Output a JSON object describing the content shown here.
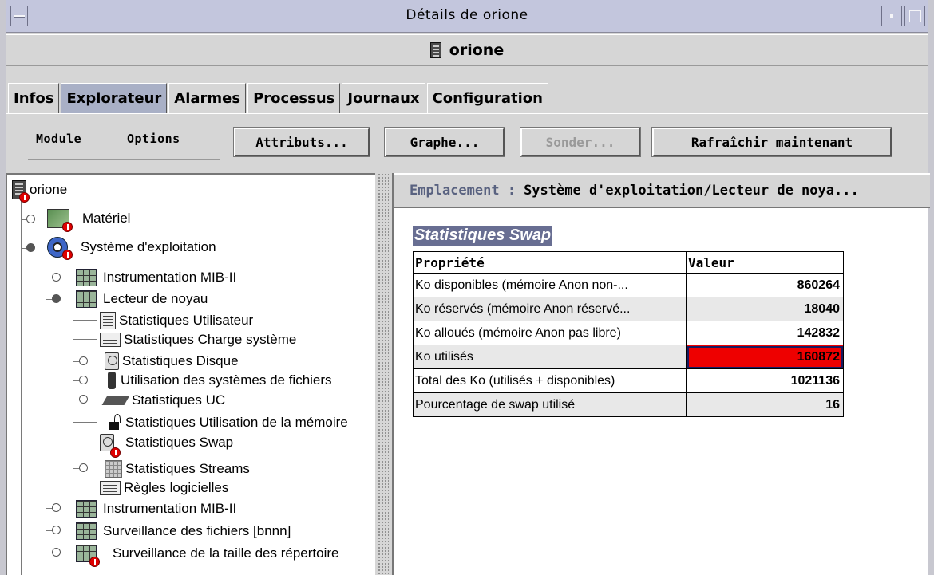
{
  "window": {
    "title": "Détails de orione"
  },
  "host": {
    "name": "orione"
  },
  "tabs": [
    {
      "label": "Infos",
      "active": false
    },
    {
      "label": "Explorateur",
      "active": true
    },
    {
      "label": "Alarmes",
      "active": false
    },
    {
      "label": "Processus",
      "active": false
    },
    {
      "label": "Journaux",
      "active": false
    },
    {
      "label": "Configuration",
      "active": false
    }
  ],
  "toolbar": {
    "menus": [
      "Module",
      "Options"
    ],
    "attributes_label": "Attributs...",
    "graph_label": "Graphe...",
    "probe_label": "Sonder...",
    "refresh_label": "Rafraîchir maintenant"
  },
  "tree": [
    {
      "label": "orione",
      "icon": "server-icon",
      "alarm": true
    },
    {
      "label": "Matériel",
      "icon": "hardware-icon",
      "alarm": true,
      "expander": "open"
    },
    {
      "label": "Système d'exploitation",
      "icon": "os-icon",
      "alarm": true,
      "expander": "filled"
    },
    {
      "label": "Instrumentation MIB-II",
      "icon": "module-icon",
      "expander": "open"
    },
    {
      "label": "Lecteur de noyau",
      "icon": "module-icon",
      "expander": "filled"
    },
    {
      "label": "Statistiques Utilisateur",
      "icon": "document-icon"
    },
    {
      "label": "Statistiques Charge système",
      "icon": "rules-icon"
    },
    {
      "label": "Statistiques Disque",
      "icon": "disk-icon",
      "expander": "open"
    },
    {
      "label": "Utilisation des systèmes de fichiers",
      "icon": "filesystem-icon",
      "expander": "open"
    },
    {
      "label": "Statistiques UC",
      "icon": "cpu-icon",
      "expander": "open"
    },
    {
      "label": "Statistiques Utilisation de la mémoire",
      "icon": "memory-icon"
    },
    {
      "label": "Statistiques Swap",
      "icon": "disk-icon",
      "alarm": true
    },
    {
      "label": "Statistiques Streams",
      "icon": "streams-icon",
      "expander": "open"
    },
    {
      "label": "Règles logicielles",
      "icon": "rules-icon"
    },
    {
      "label": "Instrumentation MIB-II",
      "icon": "module-icon",
      "expander": "open"
    },
    {
      "label": "Surveillance des fichiers [bnnn]",
      "icon": "module-icon",
      "expander": "open"
    },
    {
      "label": "Surveillance de la taille des répertoire",
      "icon": "module-icon",
      "alarm": true,
      "expander": "open"
    }
  ],
  "location": {
    "label": "Emplacement :",
    "value": "Système d'exploitation/Lecteur de noya..."
  },
  "section": {
    "title": "Statistiques Swap"
  },
  "table": {
    "headers": [
      "Propriété",
      "Valeur"
    ],
    "rows": [
      {
        "property": "Ko disponibles (mémoire Anon non-...",
        "value": "860264"
      },
      {
        "property": "Ko réservés (mémoire Anon réservé...",
        "value": "18040"
      },
      {
        "property": "Ko alloués (mémoire Anon pas libre)",
        "value": "142832"
      },
      {
        "property": "Ko utilisés",
        "value": "160872",
        "alarm": true
      },
      {
        "property": "Total des Ko (utilisés + disponibles)",
        "value": "1021136"
      },
      {
        "property": "Pourcentage de swap utilisé",
        "value": "16"
      }
    ]
  },
  "colors": {
    "title_bar": "#c3c6dd",
    "active_tab": "#a9b0c6",
    "section_title_bg": "#686e92",
    "alarm_red": "#ee0000"
  }
}
